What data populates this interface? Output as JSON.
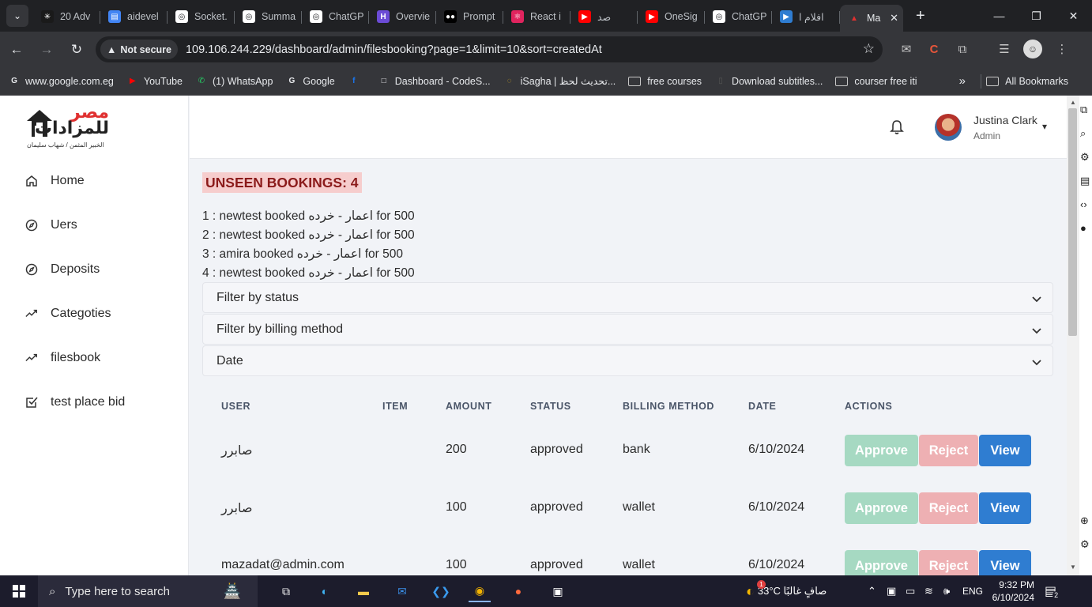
{
  "browser": {
    "tabs": [
      {
        "label": "20 Adv",
        "color": "#1a1a1a",
        "glyph": "✳"
      },
      {
        "label": "aidevel",
        "color": "#4285f4",
        "glyph": "▤"
      },
      {
        "label": "Socket.",
        "color": "#ffffff",
        "glyph": "◎"
      },
      {
        "label": "Summa",
        "color": "#ffffff",
        "glyph": "◎"
      },
      {
        "label": "ChatGP",
        "color": "#ffffff",
        "glyph": "◎"
      },
      {
        "label": "Overvie",
        "color": "#6b4bd6",
        "glyph": "H"
      },
      {
        "label": "Prompt",
        "color": "#000000",
        "glyph": "●●"
      },
      {
        "label": "React i",
        "color": "#e0245e",
        "glyph": "⚛"
      },
      {
        "label": "صد",
        "color": "#ff0000",
        "glyph": "▶"
      },
      {
        "label": "OneSig",
        "color": "#ff0000",
        "glyph": "▶"
      },
      {
        "label": "ChatGP",
        "color": "#ffffff",
        "glyph": "◎"
      },
      {
        "label": "افلام ا",
        "color": "#2f7dd1",
        "glyph": "▶"
      }
    ],
    "active_tab": {
      "label": "Ma"
    },
    "security_chip": "Not secure",
    "url": "109.106.244.229/dashboard/admin/filesbooking?page=1&limit=10&sort=createdAt",
    "bookmarks": [
      {
        "label": "www.google.com.eg",
        "icon": "G",
        "color": "#e8eaed"
      },
      {
        "label": "YouTube",
        "icon": "▶",
        "color": "#ff0000"
      },
      {
        "label": "(1) WhatsApp",
        "icon": "✆",
        "color": "#25d366"
      },
      {
        "label": "Google",
        "icon": "G",
        "color": "#e8eaed"
      },
      {
        "label": "",
        "icon": "f",
        "color": "#1877f2"
      },
      {
        "label": "Dashboard - CodeS...",
        "icon": "□",
        "color": "#e8eaed"
      },
      {
        "label": "iSagha | تحديث لحظ...",
        "icon": "◌",
        "color": "#c9a227"
      },
      {
        "label": "free courses",
        "icon": "folder",
        "color": "#c7c7c7"
      },
      {
        "label": "Download subtitles...",
        "icon": "▯",
        "color": "#555555"
      },
      {
        "label": "courser free iti",
        "icon": "folder",
        "color": "#c7c7c7"
      }
    ],
    "all_bookmarks": "All Bookmarks"
  },
  "brand": {
    "name_line1": "مصر",
    "name_line2": "للمزادات",
    "tagline": "الخبير المثمن / شهاب سليمان"
  },
  "sidebar": {
    "items": [
      {
        "label": "Home",
        "icon": "home-icon"
      },
      {
        "label": "Uers",
        "icon": "compass-icon"
      },
      {
        "label": "Deposits",
        "icon": "compass-icon"
      },
      {
        "label": "Categoties",
        "icon": "trending-up-icon"
      },
      {
        "label": "filesbook",
        "icon": "trending-up-icon"
      },
      {
        "label": "test place bid",
        "icon": "checkbox-icon"
      }
    ]
  },
  "header": {
    "user_name": "Justina Clark",
    "user_role": "Admin"
  },
  "unseen": {
    "title": "UNSEEN BOOKINGS: 4",
    "lines": [
      "1 : newtest booked اعمار - خرده for 500",
      "2 : newtest booked اعمار - خرده for 500",
      "3 : amira booked اعمار - خرده for 500",
      "4 : newtest booked اعمار - خرده for 500"
    ]
  },
  "filters": [
    {
      "label": "Filter by status"
    },
    {
      "label": "Filter by billing method"
    },
    {
      "label": "Date"
    }
  ],
  "table": {
    "columns": [
      "USER",
      "ITEM",
      "AMOUNT",
      "STATUS",
      "BILLING METHOD",
      "DATE",
      "ACTIONS"
    ],
    "rows": [
      {
        "user": "صابرر",
        "item": "",
        "amount": "200",
        "status": "approved",
        "billing": "bank",
        "date": "6/10/2024"
      },
      {
        "user": "صابرر",
        "item": "",
        "amount": "100",
        "status": "approved",
        "billing": "wallet",
        "date": "6/10/2024"
      },
      {
        "user": "mazadat@admin.com",
        "item": "",
        "amount": "100",
        "status": "approved",
        "billing": "wallet",
        "date": "6/10/2024"
      }
    ],
    "actions": {
      "approve": "Approve",
      "reject": "Reject",
      "view": "View"
    }
  },
  "taskbar": {
    "search_placeholder": "Type here to search",
    "weather": "33°C  صافٍ غالبًا",
    "weather_badge": "1",
    "lang": "ENG",
    "time": "9:32 PM",
    "date": "6/10/2024",
    "notif_count": "2"
  },
  "colors": {
    "approve_bg": "#a6d9c2",
    "reject_bg": "#eeb0b3",
    "view_bg": "#2f7dd1",
    "unseen_bg": "#f6cdcd",
    "unseen_text": "#8b1a1a"
  }
}
